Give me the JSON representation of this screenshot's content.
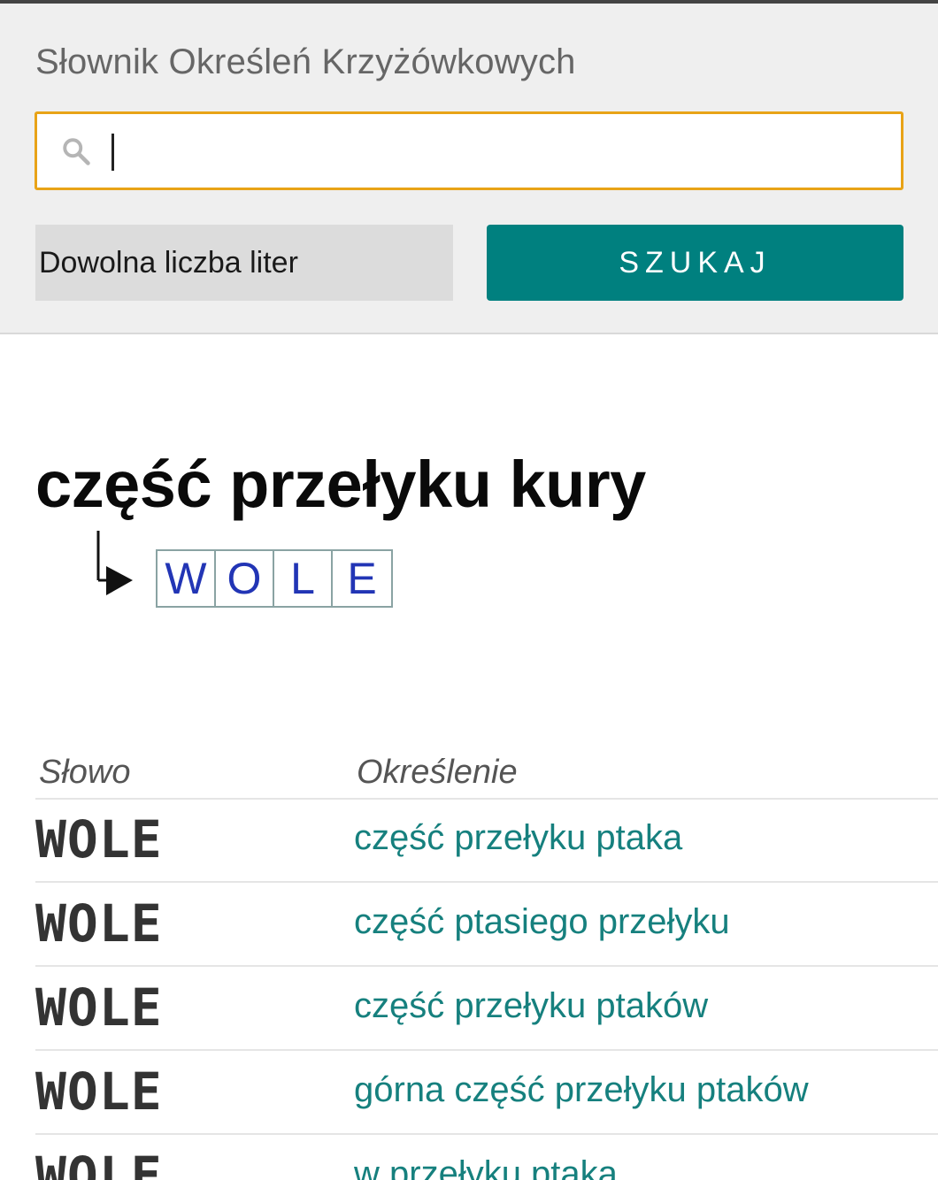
{
  "header": {
    "site_title": "Słownik Określeń Krzyżówkowych",
    "search_value": "",
    "length_select": "Dowolna liczba liter",
    "search_button": "SZUKAJ"
  },
  "result": {
    "phrase": "część przełyku kury",
    "answer_letters": [
      "W",
      "O",
      "L",
      "E"
    ]
  },
  "table": {
    "col_word": "Słowo",
    "col_definition": "Określenie",
    "rows": [
      {
        "word": "WOLE",
        "definition": "część przełyku ptaka"
      },
      {
        "word": "WOLE",
        "definition": "część ptasiego przełyku"
      },
      {
        "word": "WOLE",
        "definition": "część przełyku ptaków"
      },
      {
        "word": "WOLE",
        "definition": "górna część przełyku ptaków"
      },
      {
        "word": "WOLE",
        "definition": "w przełyku ptaka"
      }
    ]
  },
  "colors": {
    "accent": "#00807f",
    "link": "#16807e",
    "focus_border": "#e8a317",
    "answer_letters": "#2235b5"
  }
}
